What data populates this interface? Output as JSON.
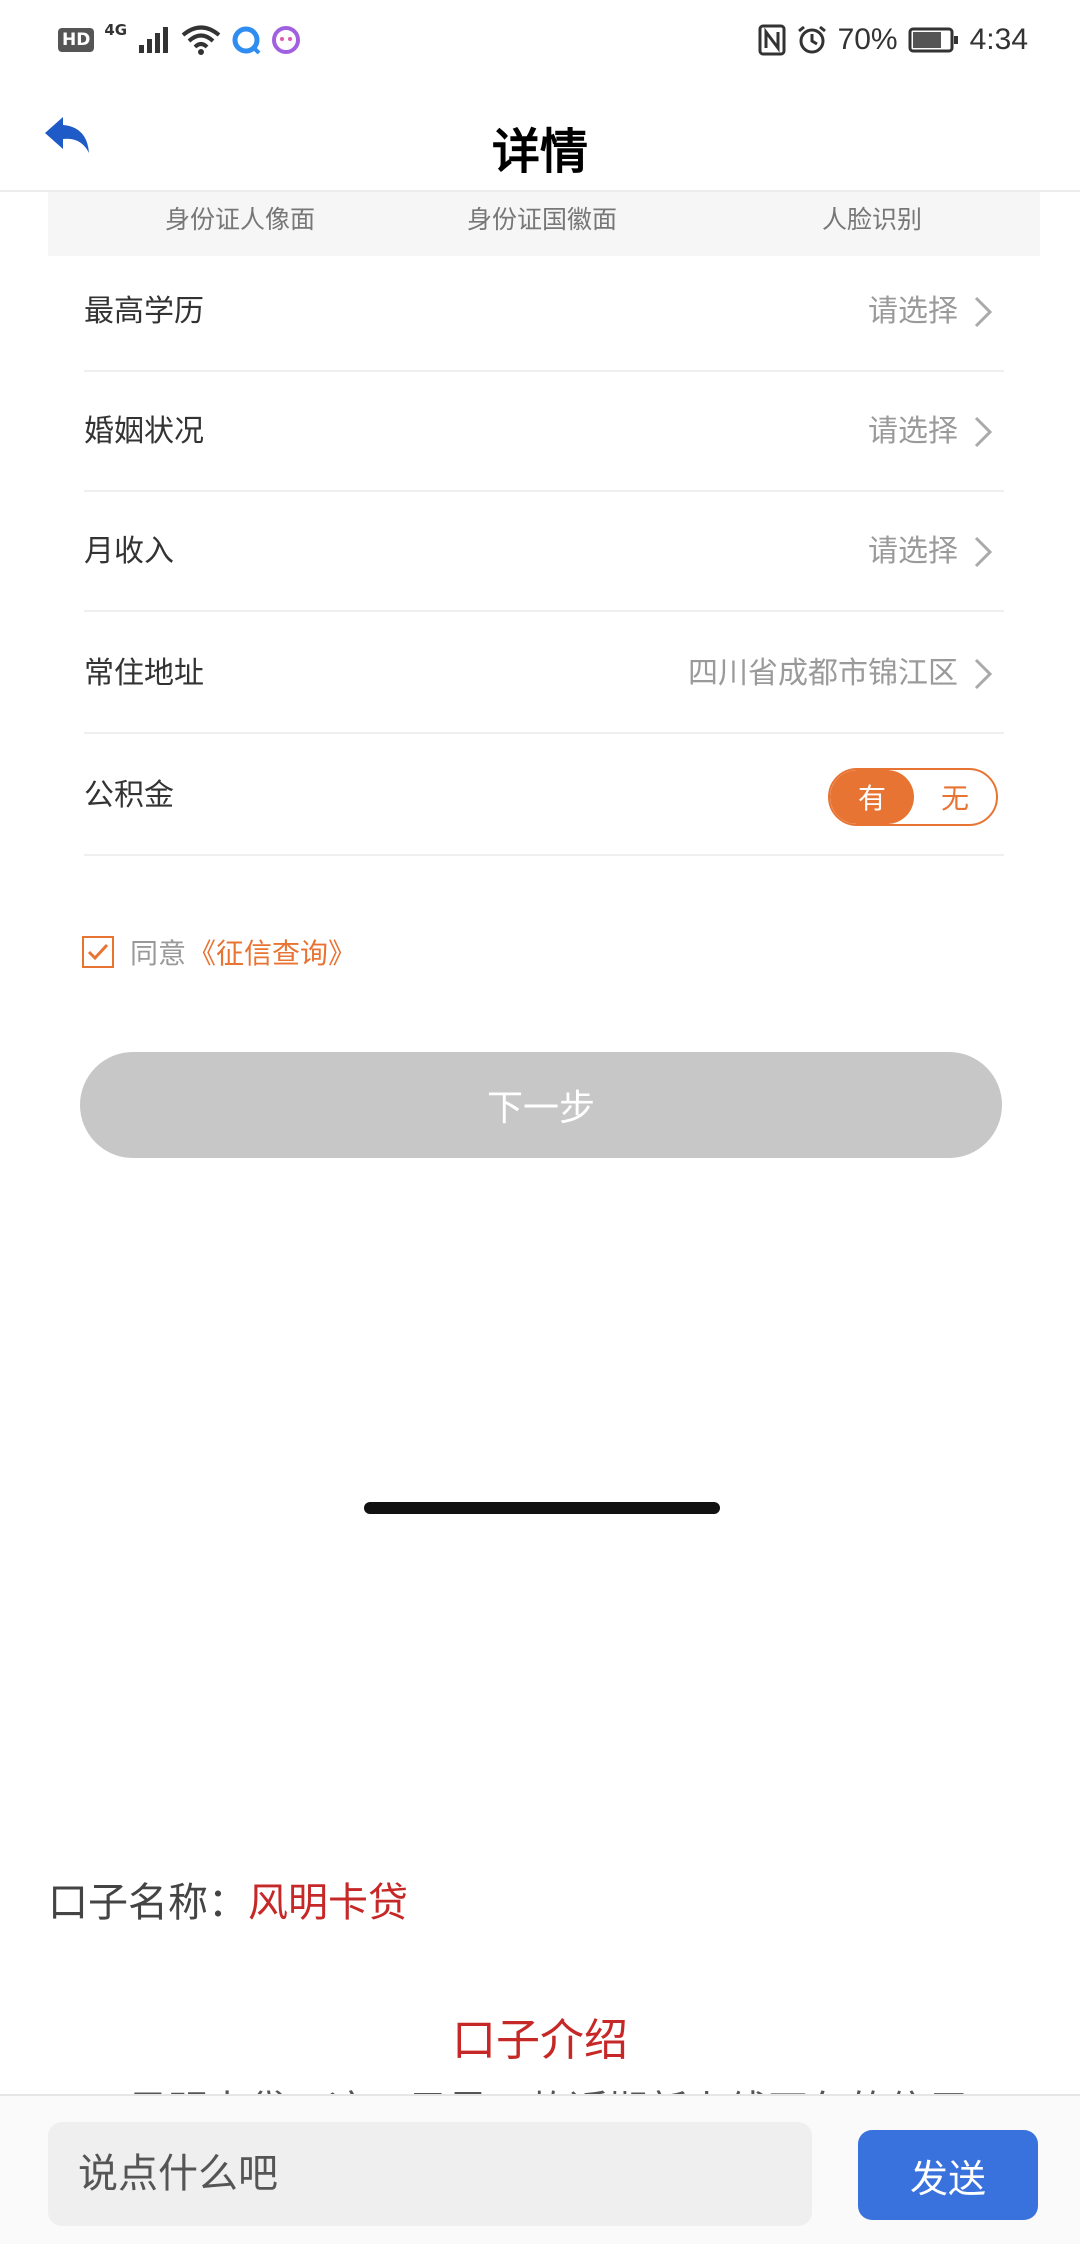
{
  "status_bar": {
    "hd": "HD",
    "network": "4G",
    "battery_percent": "70%",
    "time": "4:34"
  },
  "header": {
    "title": "详情"
  },
  "id_tabs": [
    "身份证人像面",
    "身份证国徽面",
    "人脸识别"
  ],
  "form": {
    "education": {
      "label": "最高学历",
      "value": "请选择"
    },
    "marital": {
      "label": "婚姻状况",
      "value": "请选择"
    },
    "income": {
      "label": "月收入",
      "value": "请选择"
    },
    "address": {
      "label": "常住地址",
      "value": "四川省成都市锦江区"
    },
    "fund": {
      "label": "公积金",
      "option_yes": "有",
      "option_no": "无",
      "selected": "有"
    }
  },
  "agreement": {
    "text": "同意",
    "link": "《征信查询》",
    "checked": true
  },
  "next_button": "下一步",
  "kouzi": {
    "name_label": "口子名称：",
    "name_value": "风明卡贷",
    "intro_title": "口子介绍",
    "intro_text": "风明卡贷，这二子是一款近期新上线不久的信用"
  },
  "comment_bar": {
    "placeholder": "说点什么吧",
    "send_label": "发送"
  },
  "colors": {
    "accent_orange": "#e87433",
    "brand_red": "#c62828",
    "send_blue": "#3a72dd",
    "back_icon_blue": "#1e5bc6"
  }
}
